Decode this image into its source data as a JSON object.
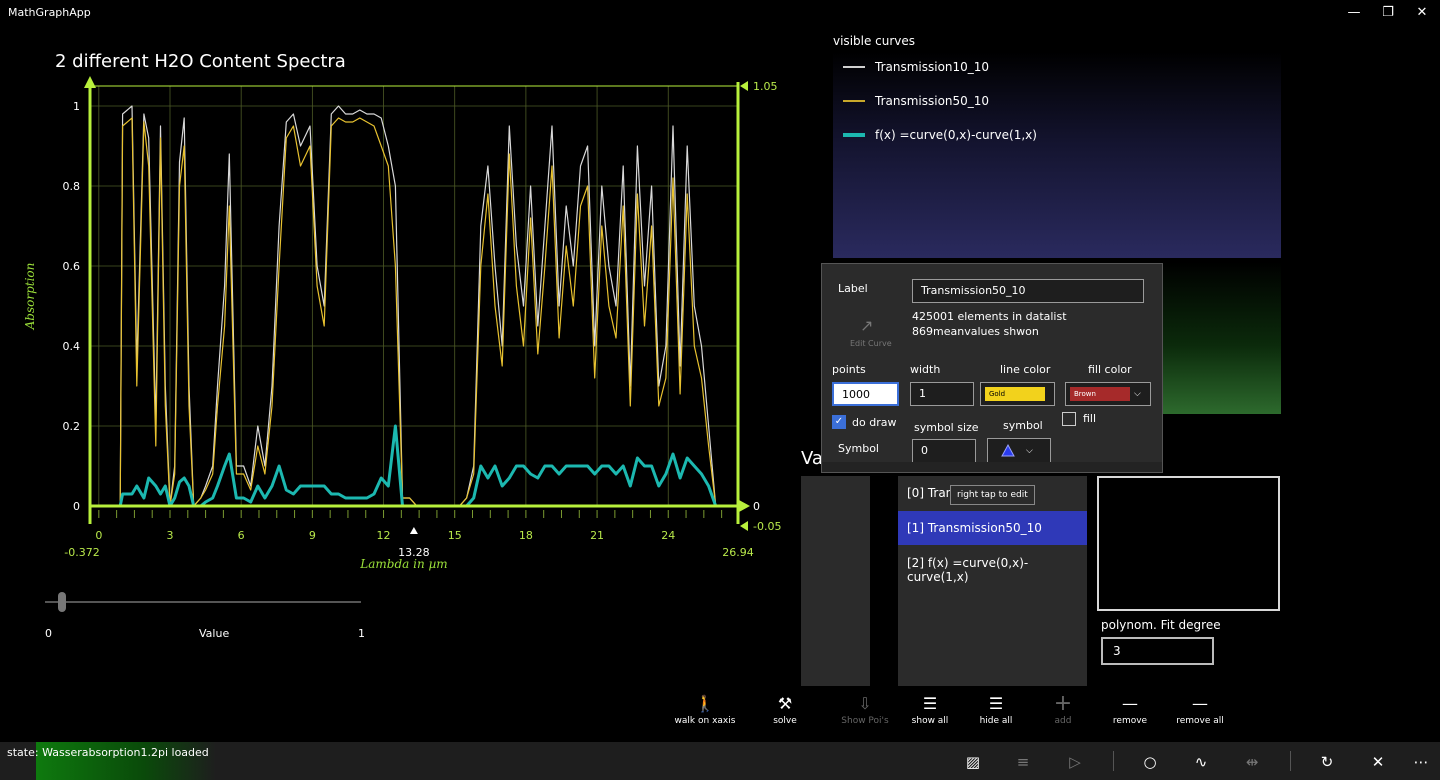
{
  "window": {
    "title": "MathGraphApp",
    "min_glyph": "—",
    "max_glyph": "❐",
    "close_glyph": "✕"
  },
  "chart_data": {
    "type": "line",
    "title": "2 different H2O Content Spectra",
    "xlabel": "Lambda in µm",
    "ylabel": "Absorption",
    "xlim": [
      -0.372,
      26.94
    ],
    "ylim": [
      0,
      1.05
    ],
    "x_ticks": [
      "0",
      "3",
      "6",
      "9",
      "12",
      "15",
      "18",
      "21",
      "24"
    ],
    "x_tick_values": [
      0,
      3,
      6,
      9,
      12,
      15,
      18,
      21,
      24
    ],
    "y_ticks": [
      "0",
      "0.2",
      "0.4",
      "0.6",
      "0.8",
      "1"
    ],
    "y_tick_values": [
      0,
      0.2,
      0.4,
      0.6,
      0.8,
      1
    ],
    "x_min_label": "-0.372",
    "x_max_label": "26.94",
    "cursor_x_label": "13.28",
    "right_top_label": "1.05",
    "right_zero_label": "0",
    "right_bottom_label": "-0.05",
    "grid": true,
    "series": [
      {
        "name": "Transmission10_10",
        "color": "#d9d9d9",
        "x": [
          0.5,
          0.9,
          1.0,
          1.4,
          1.6,
          1.9,
          2.1,
          2.4,
          2.6,
          2.8,
          3.0,
          3.2,
          3.4,
          3.6,
          3.8,
          4.0,
          4.3,
          4.5,
          4.8,
          5.0,
          5.3,
          5.5,
          5.8,
          6.1,
          6.4,
          6.7,
          7.0,
          7.3,
          7.6,
          7.9,
          8.2,
          8.5,
          8.9,
          9.2,
          9.5,
          9.8,
          10.1,
          10.4,
          10.7,
          11.0,
          11.3,
          11.6,
          11.9,
          12.2,
          12.5,
          12.8,
          13.1,
          13.4,
          13.7,
          14.0,
          14.3,
          14.6,
          14.9,
          15.2,
          15.5,
          15.8,
          16.1,
          16.4,
          16.7,
          17.0,
          17.3,
          17.6,
          17.9,
          18.2,
          18.5,
          18.8,
          19.1,
          19.4,
          19.7,
          20.0,
          20.3,
          20.6,
          20.9,
          21.2,
          21.5,
          21.8,
          22.1,
          22.4,
          22.7,
          23.0,
          23.3,
          23.6,
          23.9,
          24.2,
          24.5,
          24.8,
          25.1,
          25.4,
          25.7,
          26.0
        ],
        "y": [
          0,
          0,
          0.98,
          1.0,
          0.35,
          0.98,
          0.92,
          0.2,
          0.95,
          0.3,
          0.0,
          0.1,
          0.86,
          0.97,
          0.3,
          0.0,
          0.02,
          0.05,
          0.1,
          0.3,
          0.55,
          0.88,
          0.1,
          0.1,
          0.05,
          0.2,
          0.1,
          0.3,
          0.7,
          0.96,
          0.98,
          0.9,
          0.95,
          0.6,
          0.5,
          0.98,
          1.0,
          0.98,
          0.98,
          0.99,
          0.98,
          0.98,
          0.97,
          0.9,
          0.8,
          0.02,
          0.02,
          0.0,
          0.0,
          0.0,
          0.0,
          0.0,
          0.0,
          0.0,
          0.02,
          0.1,
          0.7,
          0.85,
          0.6,
          0.4,
          0.95,
          0.65,
          0.5,
          0.8,
          0.45,
          0.7,
          0.95,
          0.5,
          0.75,
          0.6,
          0.85,
          0.9,
          0.4,
          0.8,
          0.6,
          0.5,
          0.85,
          0.3,
          0.9,
          0.55,
          0.8,
          0.3,
          0.4,
          0.95,
          0.35,
          0.9,
          0.5,
          0.4,
          0.2,
          0.0
        ]
      },
      {
        "name": "Transmission50_10",
        "color": "#e8c230",
        "x": [
          0.5,
          0.9,
          1.0,
          1.4,
          1.6,
          1.9,
          2.1,
          2.4,
          2.6,
          2.8,
          3.0,
          3.2,
          3.4,
          3.6,
          3.8,
          4.0,
          4.3,
          4.5,
          4.8,
          5.0,
          5.3,
          5.5,
          5.8,
          6.1,
          6.4,
          6.7,
          7.0,
          7.3,
          7.6,
          7.9,
          8.2,
          8.5,
          8.9,
          9.2,
          9.5,
          9.8,
          10.1,
          10.4,
          10.7,
          11.0,
          11.3,
          11.6,
          11.9,
          12.2,
          12.5,
          12.8,
          13.1,
          13.4,
          13.7,
          14.0,
          14.3,
          14.6,
          14.9,
          15.2,
          15.5,
          15.8,
          16.1,
          16.4,
          16.7,
          17.0,
          17.3,
          17.6,
          17.9,
          18.2,
          18.5,
          18.8,
          19.1,
          19.4,
          19.7,
          20.0,
          20.3,
          20.6,
          20.9,
          21.2,
          21.5,
          21.8,
          22.1,
          22.4,
          22.7,
          23.0,
          23.3,
          23.6,
          23.9,
          24.2,
          24.5,
          24.8,
          25.1,
          25.4,
          25.7,
          26.0
        ],
        "y": [
          0,
          0,
          0.95,
          0.97,
          0.3,
          0.96,
          0.85,
          0.15,
          0.92,
          0.25,
          0.0,
          0.08,
          0.8,
          0.9,
          0.25,
          0.0,
          0.02,
          0.04,
          0.08,
          0.25,
          0.45,
          0.75,
          0.08,
          0.08,
          0.04,
          0.15,
          0.08,
          0.25,
          0.6,
          0.92,
          0.95,
          0.85,
          0.9,
          0.55,
          0.45,
          0.95,
          0.97,
          0.96,
          0.96,
          0.97,
          0.96,
          0.95,
          0.9,
          0.85,
          0.6,
          0.02,
          0.02,
          0.0,
          0.0,
          0.0,
          0.0,
          0.0,
          0.0,
          0.0,
          0.02,
          0.08,
          0.6,
          0.78,
          0.5,
          0.35,
          0.88,
          0.55,
          0.4,
          0.72,
          0.38,
          0.6,
          0.85,
          0.42,
          0.65,
          0.5,
          0.75,
          0.8,
          0.32,
          0.7,
          0.5,
          0.42,
          0.75,
          0.25,
          0.78,
          0.45,
          0.7,
          0.25,
          0.32,
          0.82,
          0.28,
          0.78,
          0.4,
          0.32,
          0.15,
          0.0
        ]
      },
      {
        "name": "f(x) =curve(0,x)-curve(1,x)",
        "color": "#1cb8b0",
        "x": [
          0.5,
          0.9,
          1.0,
          1.4,
          1.6,
          1.9,
          2.1,
          2.4,
          2.6,
          2.8,
          3.0,
          3.2,
          3.4,
          3.6,
          3.8,
          4.0,
          4.3,
          4.5,
          4.8,
          5.0,
          5.3,
          5.5,
          5.8,
          6.1,
          6.4,
          6.7,
          7.0,
          7.3,
          7.6,
          7.9,
          8.2,
          8.5,
          8.9,
          9.2,
          9.5,
          9.8,
          10.1,
          10.4,
          10.7,
          11.0,
          11.3,
          11.6,
          11.9,
          12.2,
          12.5,
          12.8,
          13.1,
          13.4,
          13.7,
          14.0,
          14.3,
          14.6,
          14.9,
          15.2,
          15.5,
          15.8,
          16.1,
          16.4,
          16.7,
          17.0,
          17.3,
          17.6,
          17.9,
          18.2,
          18.5,
          18.8,
          19.1,
          19.4,
          19.7,
          20.0,
          20.3,
          20.6,
          20.9,
          21.2,
          21.5,
          21.8,
          22.1,
          22.4,
          22.7,
          23.0,
          23.3,
          23.6,
          23.9,
          24.2,
          24.5,
          24.8,
          25.1,
          25.4,
          25.7,
          26.0
        ],
        "y": [
          0,
          0,
          0.03,
          0.03,
          0.05,
          0.02,
          0.07,
          0.05,
          0.03,
          0.05,
          0.0,
          0.02,
          0.06,
          0.07,
          0.05,
          0.0,
          0.0,
          0.01,
          0.02,
          0.05,
          0.1,
          0.13,
          0.02,
          0.02,
          0.01,
          0.05,
          0.02,
          0.05,
          0.1,
          0.04,
          0.03,
          0.05,
          0.05,
          0.05,
          0.05,
          0.03,
          0.03,
          0.02,
          0.02,
          0.02,
          0.02,
          0.03,
          0.07,
          0.05,
          0.2,
          0.0,
          0.0,
          0.0,
          0.0,
          0.0,
          0.0,
          0.0,
          0.0,
          0.0,
          0.0,
          0.02,
          0.1,
          0.07,
          0.1,
          0.05,
          0.07,
          0.1,
          0.1,
          0.08,
          0.07,
          0.1,
          0.1,
          0.08,
          0.1,
          0.1,
          0.1,
          0.1,
          0.08,
          0.1,
          0.1,
          0.08,
          0.1,
          0.05,
          0.12,
          0.1,
          0.1,
          0.05,
          0.08,
          0.13,
          0.07,
          0.12,
          0.1,
          0.08,
          0.05,
          0.0
        ]
      }
    ]
  },
  "slider": {
    "min_label": "0",
    "label": "Value",
    "max_label": "1",
    "value": 0.05
  },
  "visible_curves": {
    "title": "visible curves",
    "items": [
      {
        "label": "Transmission10_10",
        "color": "#d0d0d0"
      },
      {
        "label": "Transmission50_10",
        "color": "#c8a82a"
      },
      {
        "label": "f(x) =curve(0,x)-curve(1,x)",
        "color": "#1cb8b0"
      }
    ]
  },
  "editor": {
    "label_caption": "Label",
    "label_value": "Transmission50_10",
    "info_line1": "425001 elements in datalist",
    "info_line2": "869meanvalues shwon",
    "edit_curve": "Edit Curve",
    "points_caption": "points",
    "points_value": "1000",
    "width_caption": "width",
    "width_value": "1",
    "line_color_caption": "line color",
    "line_color_value": "Gold",
    "line_color_hex": "#f2d21c",
    "fill_color_caption": "fill color",
    "fill_color_value": "Brown",
    "fill_color_hex": "#a62a2a",
    "do_draw": "do draw",
    "fill": "fill",
    "symbol_size_caption": "symbol size",
    "symbol_size_value": "0",
    "symbol_caption": "symbol",
    "symbol_label": "Symbol"
  },
  "values_header": "Va",
  "curve_list": {
    "items": [
      "[0] Trans",
      "[1] Transmission50_10",
      "[2] f(x) =curve(0,x)-curve(1,x)"
    ],
    "selected": 1,
    "tooltip": "right tap to edit"
  },
  "fit": {
    "label": "polynom. Fit degree",
    "value": "3"
  },
  "toolbar": [
    {
      "label": "walk on xaxis",
      "icon": "walk-icon",
      "glyph": "🚶",
      "enabled": true
    },
    {
      "label": "solve",
      "icon": "solve-icon",
      "glyph": "⚒",
      "enabled": true
    },
    {
      "label": "Show Poi's",
      "icon": "poi-icon",
      "glyph": "⇩",
      "enabled": false
    },
    {
      "label": "show all",
      "icon": "list-icon",
      "glyph": "☰",
      "enabled": true
    },
    {
      "label": "hide all",
      "icon": "list-icon",
      "glyph": "☰",
      "enabled": true
    },
    {
      "label": "add",
      "icon": "add-icon",
      "glyph": "+",
      "enabled": false
    },
    {
      "label": "remove",
      "icon": "remove-icon",
      "glyph": "—",
      "enabled": true
    },
    {
      "label": "remove all",
      "icon": "remove-all-icon",
      "glyph": "—",
      "enabled": true
    }
  ],
  "status": {
    "text": "state: Wasserabsorption1.2pi loaded"
  }
}
